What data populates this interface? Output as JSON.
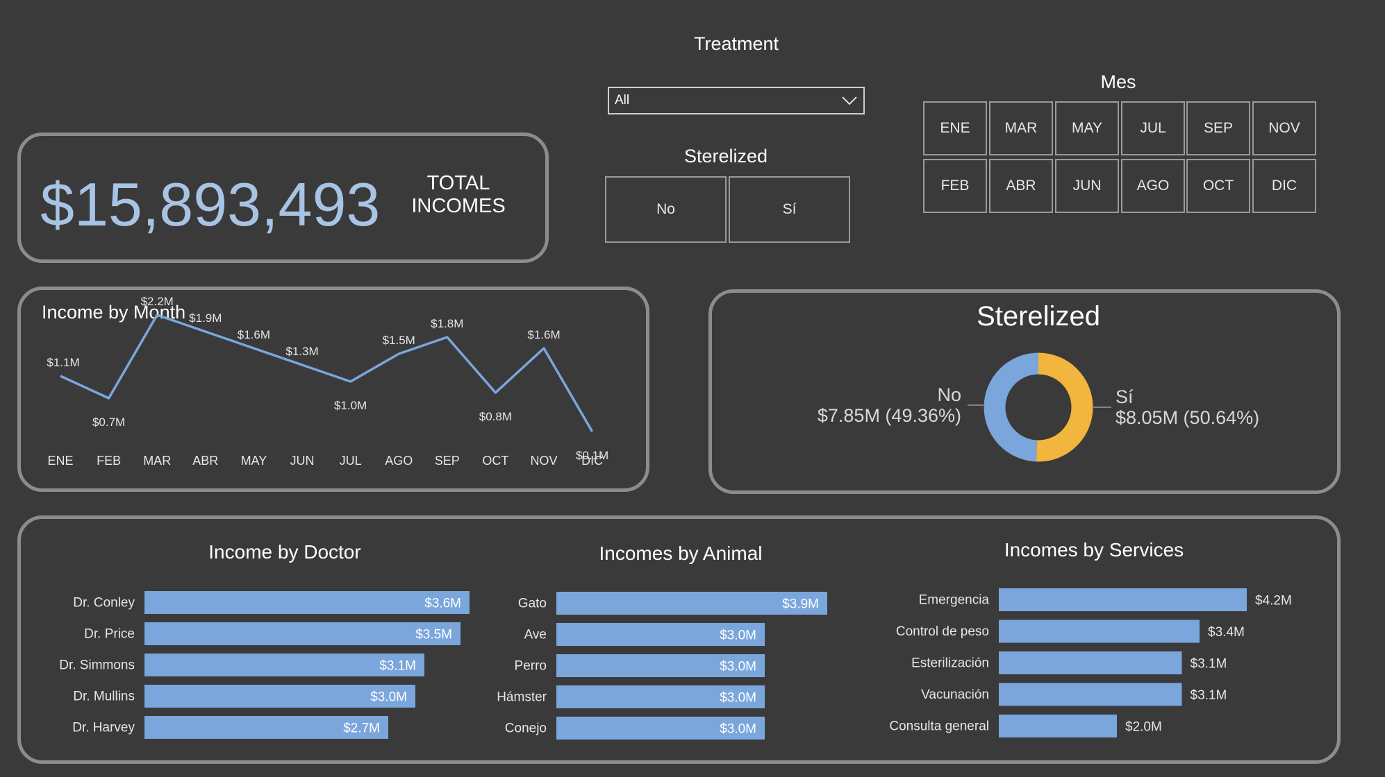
{
  "filters": {
    "treatment": {
      "title": "Treatment",
      "selected": "All"
    },
    "sterilized": {
      "title": "Sterelized",
      "options": [
        "No",
        "Sí"
      ]
    },
    "month": {
      "title": "Mes",
      "options": [
        "ENE",
        "MAR",
        "MAY",
        "JUL",
        "SEP",
        "NOV",
        "FEB",
        "ABR",
        "JUN",
        "AGO",
        "OCT",
        "DIC"
      ]
    }
  },
  "kpi": {
    "value": "$15,893,493",
    "label_line1": "TOTAL",
    "label_line2": "INCOMES"
  },
  "colors": {
    "accent_blue": "#7aa6dc",
    "accent_gold": "#f2b53d",
    "panel_border": "#8c8c8c",
    "background": "#3a3a3a"
  },
  "chart_data": [
    {
      "type": "line",
      "title": "Income by Month",
      "categories": [
        "ENE",
        "FEB",
        "MAR",
        "ABR",
        "MAY",
        "JUN",
        "JUL",
        "AGO",
        "SEP",
        "OCT",
        "NOV",
        "DIC"
      ],
      "values": [
        1.1,
        0.7,
        2.2,
        1.9,
        1.6,
        1.3,
        1.0,
        1.5,
        1.8,
        0.8,
        1.6,
        0.1
      ],
      "labels": [
        "$1.1M",
        "$0.7M",
        "$2.2M",
        "$1.9M",
        "$1.6M",
        "$1.3M",
        "$1.0M",
        "$1.5M",
        "$1.8M",
        "$0.8M",
        "$1.6M",
        "$0.1M"
      ],
      "grid": false
    },
    {
      "type": "pie",
      "title": "Sterelized",
      "categories": [
        "No",
        "Sí"
      ],
      "values": [
        7.85,
        8.05
      ],
      "labels": [
        "$7.85M (49.36%)",
        "$8.05M (50.64%)"
      ],
      "percent": [
        49.36,
        50.64
      ]
    },
    {
      "type": "bar",
      "title": "Income by Doctor",
      "categories": [
        "Dr. Conley",
        "Dr. Price",
        "Dr. Simmons",
        "Dr. Mullins",
        "Dr. Harvey"
      ],
      "values": [
        3.6,
        3.5,
        3.1,
        3.0,
        2.7
      ],
      "labels": [
        "$3.6M",
        "$3.5M",
        "$3.1M",
        "$3.0M",
        "$2.7M"
      ]
    },
    {
      "type": "bar",
      "title": "Incomes by Animal",
      "categories": [
        "Gato",
        "Ave",
        "Perro",
        "Hámster",
        "Conejo"
      ],
      "values": [
        3.9,
        3.0,
        3.0,
        3.0,
        3.0
      ],
      "labels": [
        "$3.9M",
        "$3.0M",
        "$3.0M",
        "$3.0M",
        "$3.0M"
      ]
    },
    {
      "type": "bar",
      "title": "Incomes by Services",
      "categories": [
        "Emergencia",
        "Control de peso",
        "Esterilización",
        "Vacunación",
        "Consulta general"
      ],
      "values": [
        4.2,
        3.4,
        3.1,
        3.1,
        2.0
      ],
      "labels": [
        "$4.2M",
        "$3.4M",
        "$3.1M",
        "$3.1M",
        "$2.0M"
      ]
    }
  ]
}
